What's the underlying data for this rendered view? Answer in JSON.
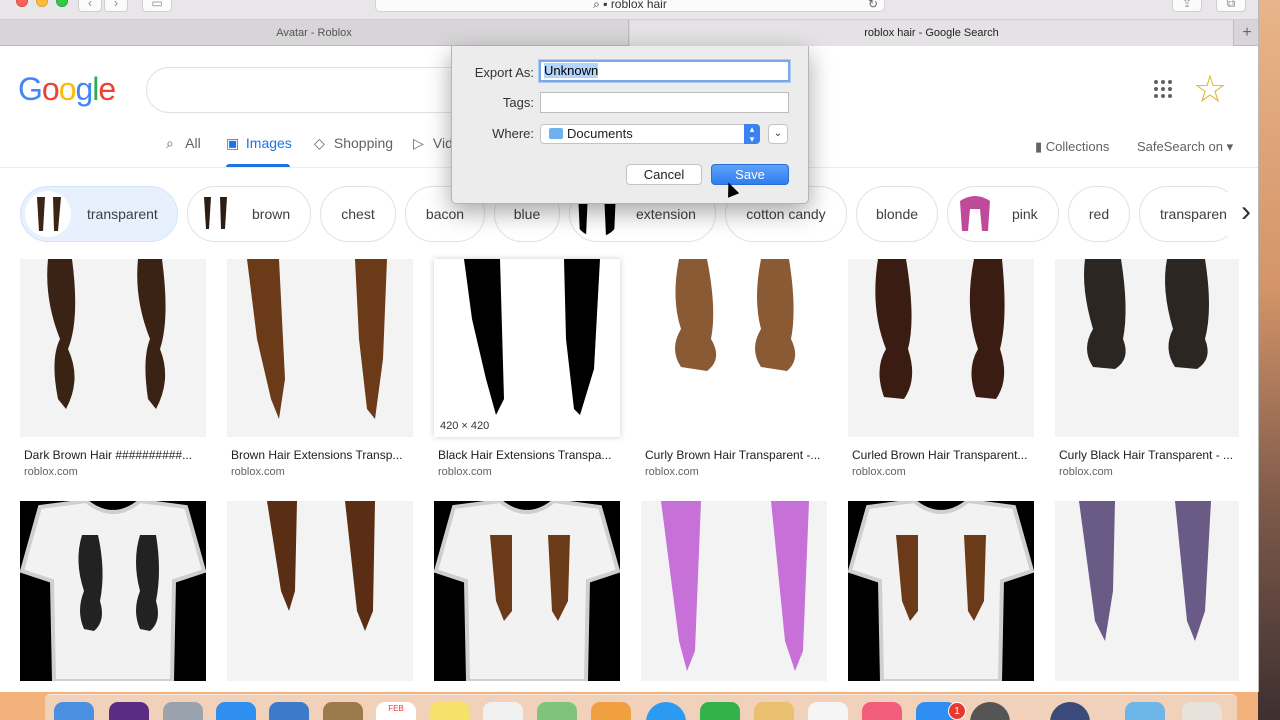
{
  "browser": {
    "address": "roblox hair",
    "tabs": [
      {
        "title": "Avatar - Roblox"
      },
      {
        "title": "roblox hair - Google Search"
      }
    ]
  },
  "google": {
    "logo": "Google",
    "nav": [
      {
        "label": "All",
        "icon": "search-icon"
      },
      {
        "label": "Images",
        "icon": "image-icon",
        "active": true
      },
      {
        "label": "Shopping",
        "icon": "tag-icon"
      },
      {
        "label": "Vid",
        "icon": "video-icon"
      }
    ],
    "collections": "Collections",
    "safesearch": "SafeSearch on"
  },
  "chips": [
    "transparent",
    "brown",
    "chest",
    "bacon",
    "blue",
    "extension",
    "cotton candy",
    "blonde",
    "pink",
    "red",
    "transparen"
  ],
  "results_row1": [
    {
      "title": "Dark Brown Hair ##########...",
      "source": "roblox.com"
    },
    {
      "title": "Brown Hair Extensions Transp...",
      "source": "roblox.com"
    },
    {
      "title": "Black Hair Extensions Transpa...",
      "source": "roblox.com",
      "dimensions": "420 × 420"
    },
    {
      "title": "Curly Brown Hair Transparent -...",
      "source": "roblox.com"
    },
    {
      "title": "Curled Brown Hair Transparent...",
      "source": "roblox.com"
    },
    {
      "title": "Curly Black Hair Transparent - ...",
      "source": "roblox.com"
    }
  ],
  "dialog": {
    "export_label": "Export As:",
    "export_value": "Unknown",
    "tags_label": "Tags:",
    "tags_value": "",
    "where_label": "Where:",
    "where_value": "Documents",
    "cancel": "Cancel",
    "save": "Save"
  },
  "dock": {
    "calendar_month": "FEB",
    "mail_badge": "1"
  },
  "colors": {
    "accent": "#1a73e8",
    "save_button": "#2d7ef0"
  }
}
